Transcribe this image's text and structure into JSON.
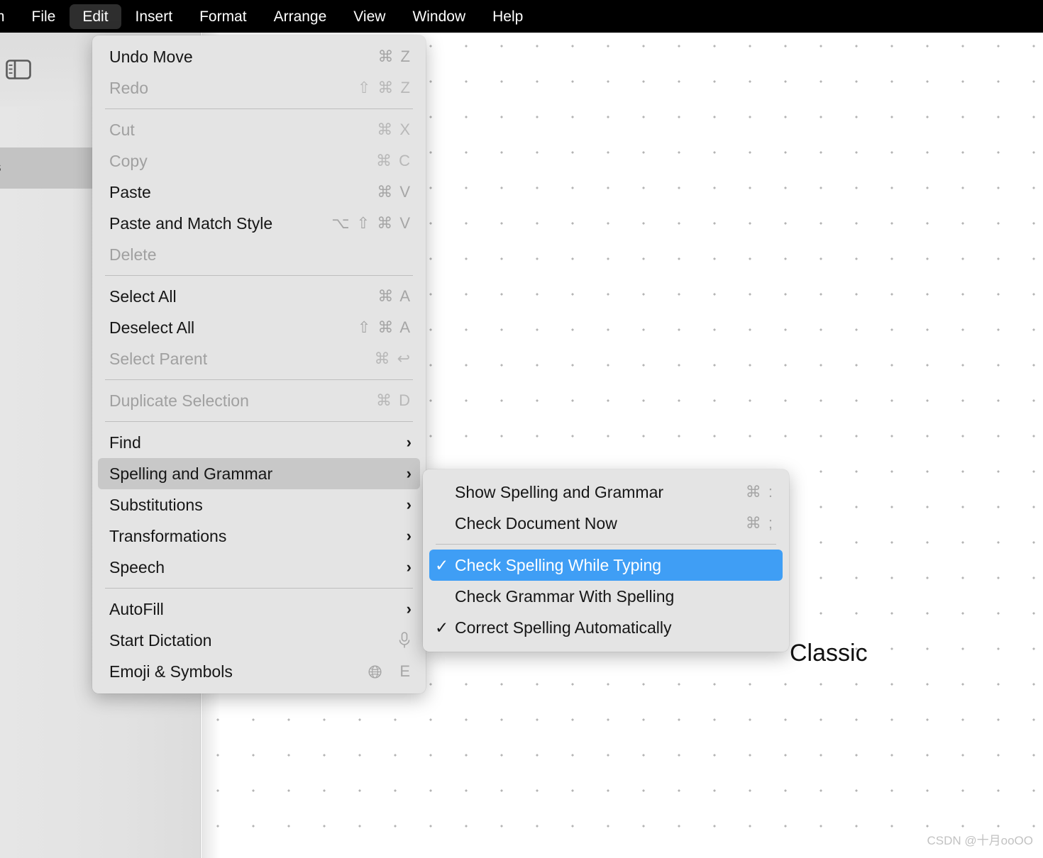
{
  "menubar": {
    "items": [
      {
        "label": "rm",
        "active": false,
        "truncated": true
      },
      {
        "label": "File",
        "active": false
      },
      {
        "label": "Edit",
        "active": true
      },
      {
        "label": "Insert",
        "active": false
      },
      {
        "label": "Format",
        "active": false
      },
      {
        "label": "Arrange",
        "active": false
      },
      {
        "label": "View",
        "active": false
      },
      {
        "label": "Window",
        "active": false
      },
      {
        "label": "Help",
        "active": false
      }
    ]
  },
  "sidebar": {
    "toggle_icon": "sidebar-toggle-icon",
    "rows": [
      {
        "label": "",
        "selected": false
      },
      {
        "label": "s",
        "selected": true
      },
      {
        "label": "",
        "selected": false
      }
    ]
  },
  "canvas": {
    "text_classic": "Classic"
  },
  "edit_menu": {
    "groups": [
      {
        "items": [
          {
            "label": "Undo Move",
            "shortcut": "⌘ Z",
            "disabled": false
          },
          {
            "label": "Redo",
            "shortcut": "⇧ ⌘ Z",
            "disabled": true
          }
        ]
      },
      {
        "items": [
          {
            "label": "Cut",
            "shortcut": "⌘ X",
            "disabled": true
          },
          {
            "label": "Copy",
            "shortcut": "⌘ C",
            "disabled": true
          },
          {
            "label": "Paste",
            "shortcut": "⌘ V",
            "disabled": false
          },
          {
            "label": "Paste and Match Style",
            "shortcut": "⌥ ⇧ ⌘ V",
            "disabled": false
          },
          {
            "label": "Delete",
            "shortcut": "",
            "disabled": true
          }
        ]
      },
      {
        "items": [
          {
            "label": "Select All",
            "shortcut": "⌘ A",
            "disabled": false
          },
          {
            "label": "Deselect All",
            "shortcut": "⇧ ⌘ A",
            "disabled": false
          },
          {
            "label": "Select Parent",
            "shortcut": "⌘ ↩",
            "disabled": true
          }
        ]
      },
      {
        "items": [
          {
            "label": "Duplicate Selection",
            "shortcut": "⌘ D",
            "disabled": true
          }
        ]
      },
      {
        "items": [
          {
            "label": "Find",
            "submenu": true,
            "disabled": false
          },
          {
            "label": "Spelling and Grammar",
            "submenu": true,
            "disabled": false,
            "highlighted": true
          },
          {
            "label": "Substitutions",
            "submenu": true,
            "disabled": false
          },
          {
            "label": "Transformations",
            "submenu": true,
            "disabled": false
          },
          {
            "label": "Speech",
            "submenu": true,
            "disabled": false
          }
        ]
      },
      {
        "items": [
          {
            "label": "AutoFill",
            "submenu": true,
            "disabled": false
          },
          {
            "label": "Start Dictation",
            "glyph": "microphone-icon",
            "disabled": false
          },
          {
            "label": "Emoji & Symbols",
            "glyph": "globe-icon",
            "shortcut": "E",
            "disabled": false
          }
        ]
      }
    ]
  },
  "spelling_submenu": {
    "groups": [
      {
        "items": [
          {
            "label": "Show Spelling and Grammar",
            "shortcut": "⌘ :",
            "checked": false,
            "selected": false
          },
          {
            "label": "Check Document Now",
            "shortcut": "⌘ ;",
            "checked": false,
            "selected": false
          }
        ]
      },
      {
        "items": [
          {
            "label": "Check Spelling While Typing",
            "shortcut": "",
            "checked": true,
            "selected": true
          },
          {
            "label": "Check Grammar With Spelling",
            "shortcut": "",
            "checked": false,
            "selected": false
          },
          {
            "label": "Correct Spelling Automatically",
            "shortcut": "",
            "checked": true,
            "selected": false
          }
        ]
      }
    ]
  },
  "watermark": {
    "text": "CSDN @十月ooOO"
  },
  "colors": {
    "menubar_bg": "#000000",
    "menu_bg": "#e4e4e4",
    "highlight_gray": "#c8c8c8",
    "selection_blue": "#3f9ef5",
    "sidebar_bg": "#e2e2e2",
    "canvas_bg": "#ffffff",
    "dot_grid": "#b4b4b4"
  }
}
